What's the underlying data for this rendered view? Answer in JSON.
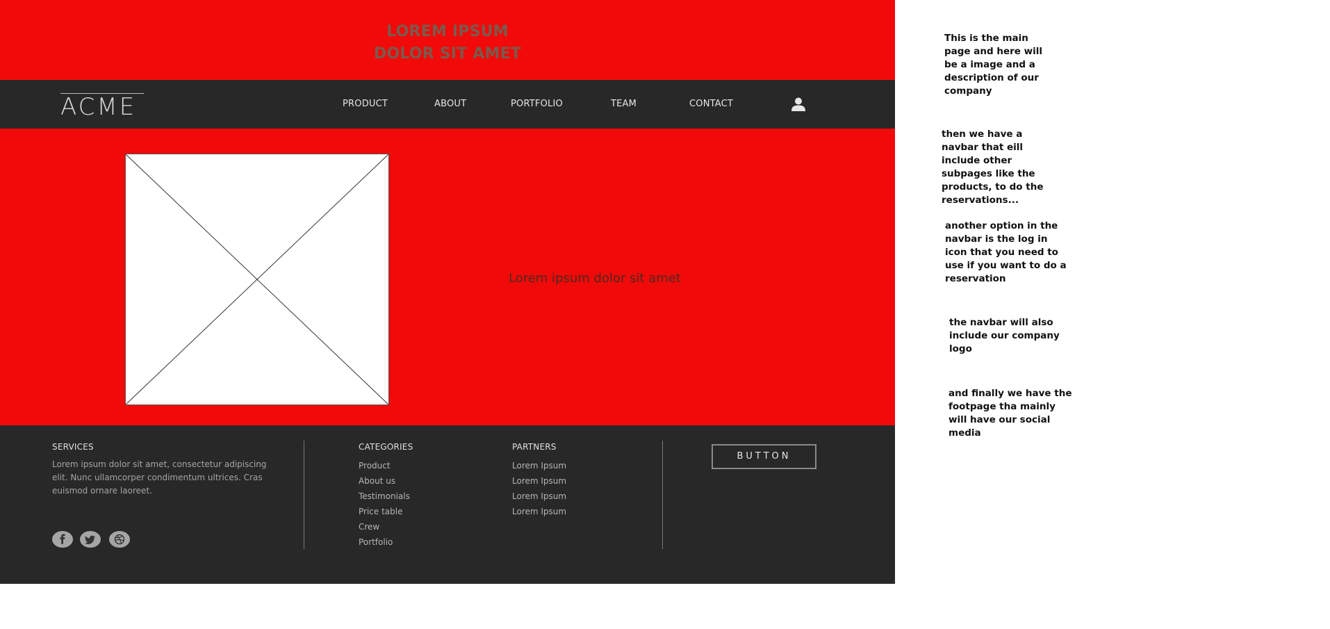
{
  "top_banner": {
    "title_line1": "LOREM IPSUM",
    "title_line2": "DOLOR SIT AMET"
  },
  "navbar": {
    "logo": "ACME",
    "items": [
      {
        "label": "PRODUCT"
      },
      {
        "label": "ABOUT"
      },
      {
        "label": "PORTFOLIO"
      },
      {
        "label": "TEAM"
      },
      {
        "label": "CONTACT"
      }
    ],
    "user_icon": "user-icon"
  },
  "hero": {
    "image_placeholder": "image-placeholder-icon",
    "text": "Lorem ipsum dolor sit amet"
  },
  "footer": {
    "services": {
      "heading": "SERVICES",
      "description": "Lorem ipsum dolor sit amet, consectetur adipiscing elit. Nunc ullamcorper condimentum ultrices. Cras euismod ornare laoreet."
    },
    "social_icons": [
      "facebook-icon",
      "twitter-icon",
      "dribbble-icon"
    ],
    "categories": {
      "heading": "CATEGORIES",
      "links": [
        "Product",
        "About us",
        "Testimonials",
        "Price table",
        "Crew",
        "Portfolio"
      ]
    },
    "partners": {
      "heading": "PARTNERS",
      "links": [
        "Lorem Ipsum",
        "Lorem Ipsum",
        "Lorem Ipsum",
        "Lorem Ipsum"
      ]
    },
    "button_label": "BUTTON"
  },
  "notes": [
    "This is the main page and here will be a image and a description of our company",
    "then we have a navbar that eill include other subpages like the products, to do the reservations...",
    "another option in the navbar is the log in icon that you need to use if you want to do a reservation",
    "the navbar will also include our company logo",
    "and finally we have the footpage tha mainly will have our social media"
  ],
  "colors": {
    "primary_red": "#f10a09",
    "dark_bar": "#282828",
    "muted_title": "#7a5a4e"
  }
}
